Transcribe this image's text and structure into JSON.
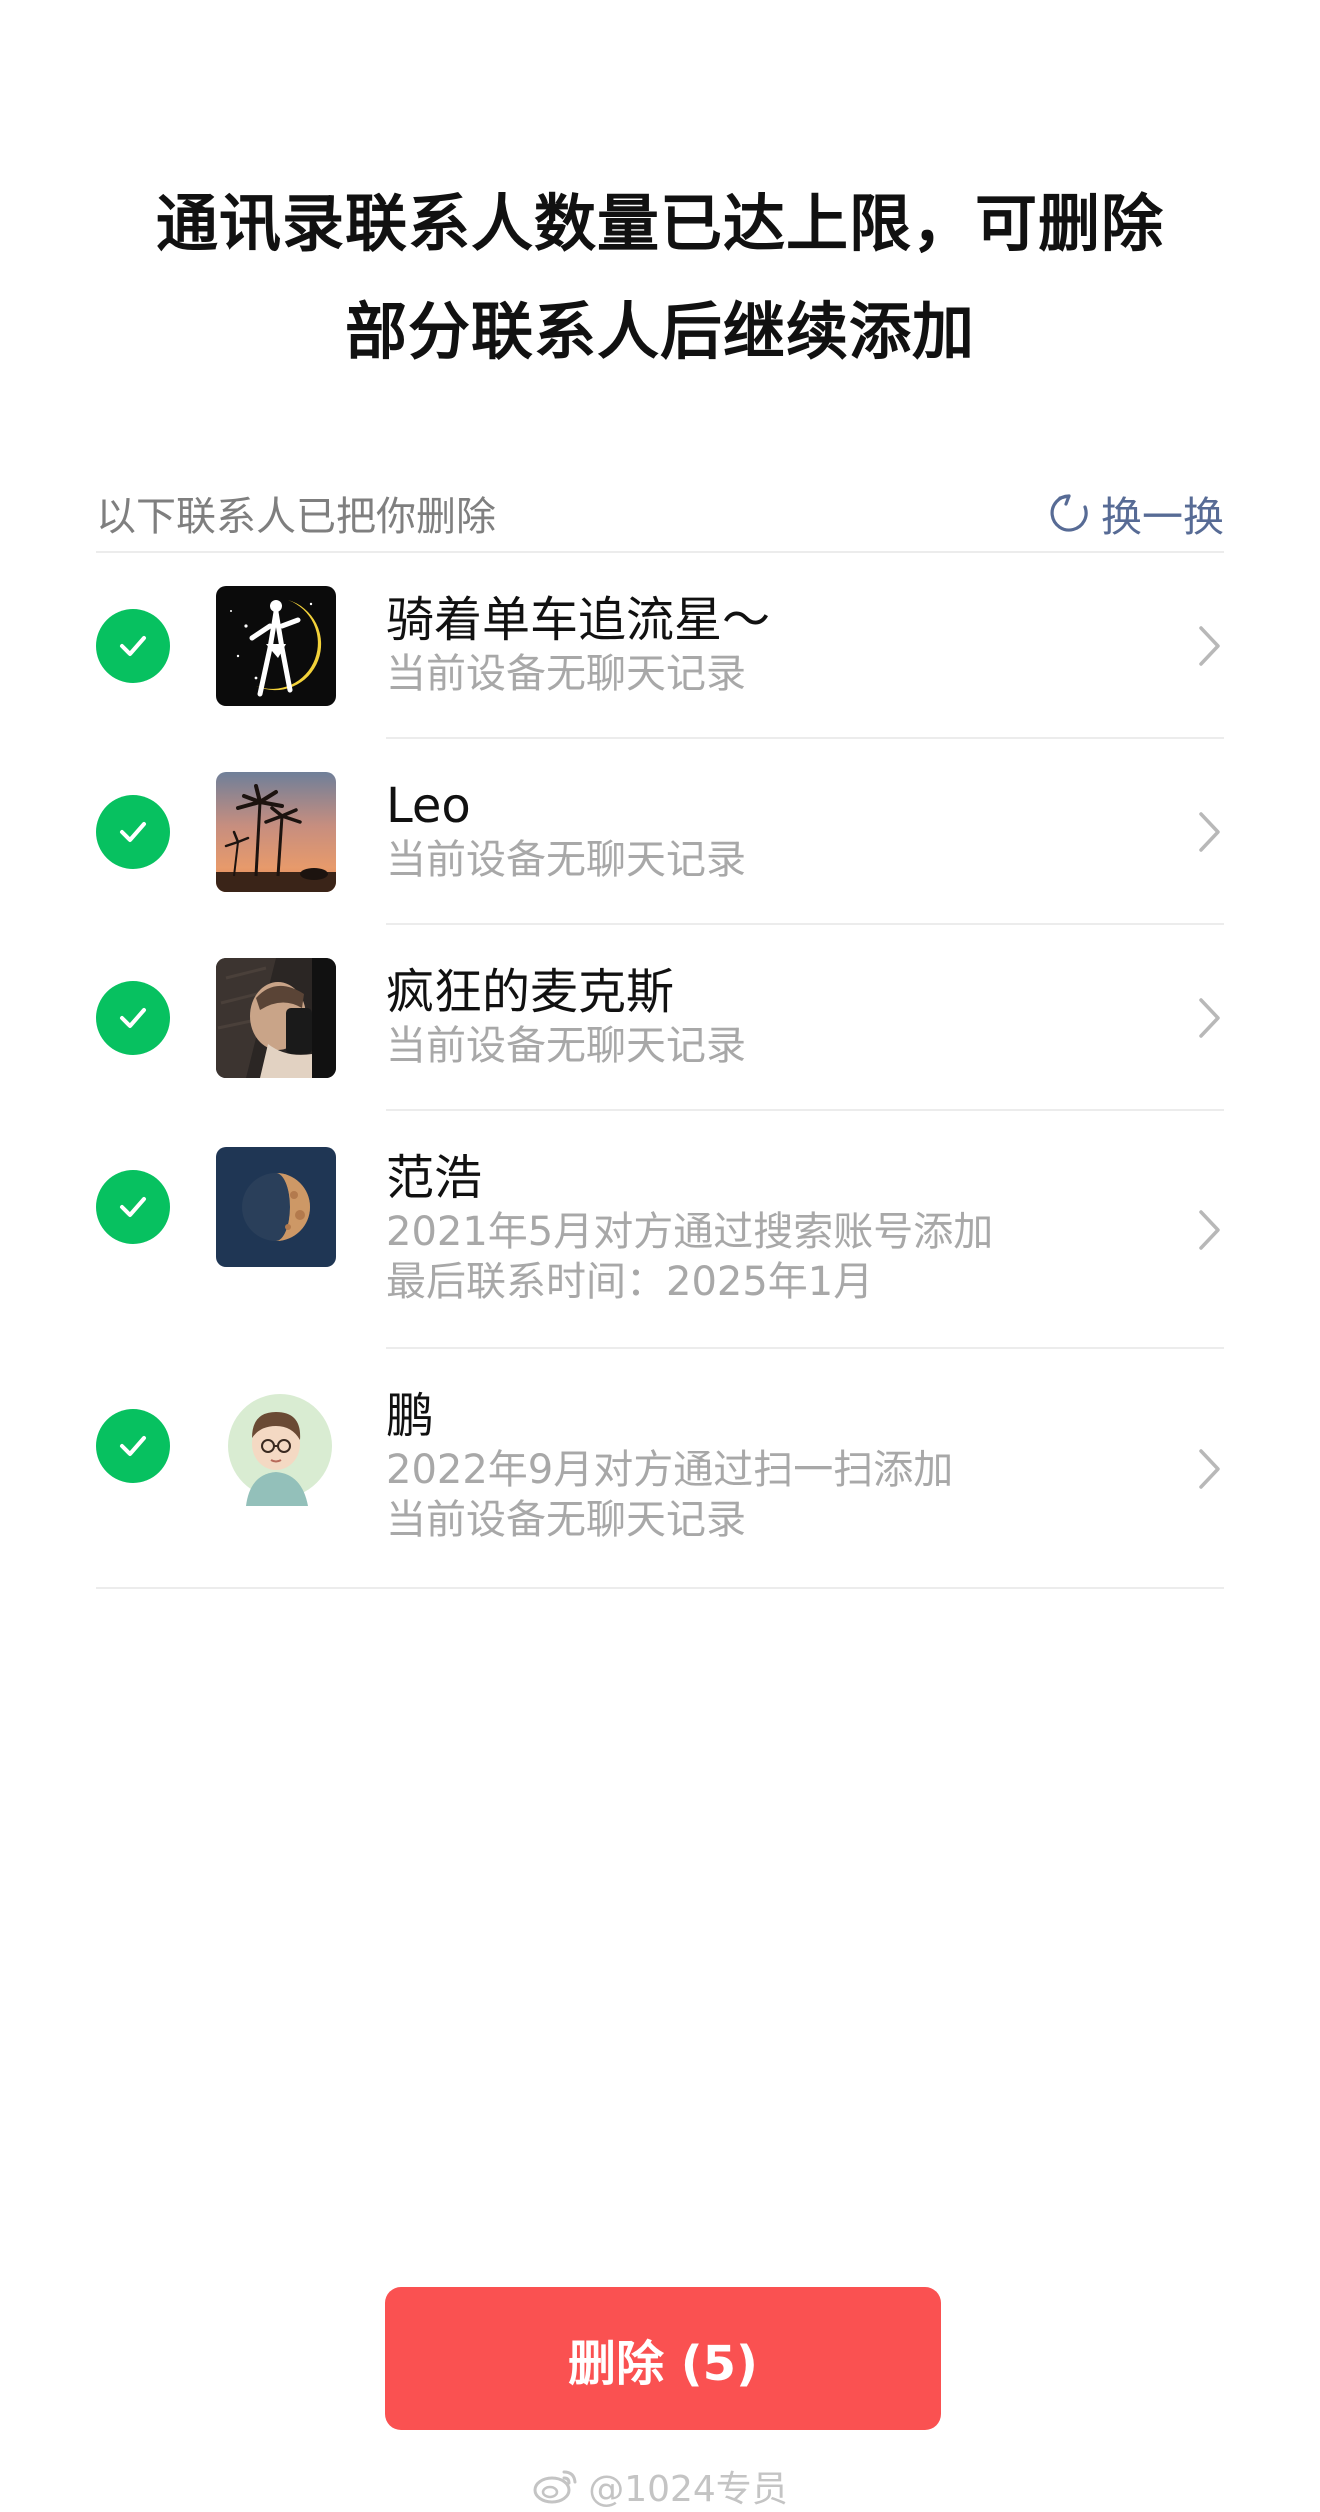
{
  "title": {
    "line1": "通讯录联系人数量已达上限，可删除",
    "line2": "部分联系人后继续添加"
  },
  "section": {
    "label": "以下联系人已把你删除",
    "refresh_label": "换一换",
    "refresh_icon": "refresh-icon"
  },
  "contacts": [
    {
      "name": "骑着单车追流星～",
      "lines": [
        "当前设备无聊天记录"
      ],
      "selected": true,
      "avatar": "sailor-moon-silhouette"
    },
    {
      "name": "Leo",
      "lines": [
        "当前设备无聊天记录"
      ],
      "selected": true,
      "avatar": "palm-trees-sunset"
    },
    {
      "name": "疯狂的麦克斯",
      "lines": [
        "当前设备无聊天记录"
      ],
      "selected": true,
      "avatar": "person-with-phone"
    },
    {
      "name": "范浩",
      "lines": [
        "2021年5月对方通过搜索账号添加",
        "最后联系时间：2025年1月"
      ],
      "selected": true,
      "avatar": "half-moon"
    },
    {
      "name": "鹏",
      "lines": [
        "2022年9月对方通过扫一扫添加",
        "当前设备无聊天记录"
      ],
      "selected": true,
      "avatar": "cartoon-boy-with-glasses"
    }
  ],
  "delete_button": {
    "label": "删除 (5)"
  },
  "watermark": {
    "text": "@1024专员",
    "icon": "weibo-icon"
  },
  "colors": {
    "accent_green": "#07c160",
    "delete_red": "#fa5151",
    "link_blue": "#576b95"
  }
}
